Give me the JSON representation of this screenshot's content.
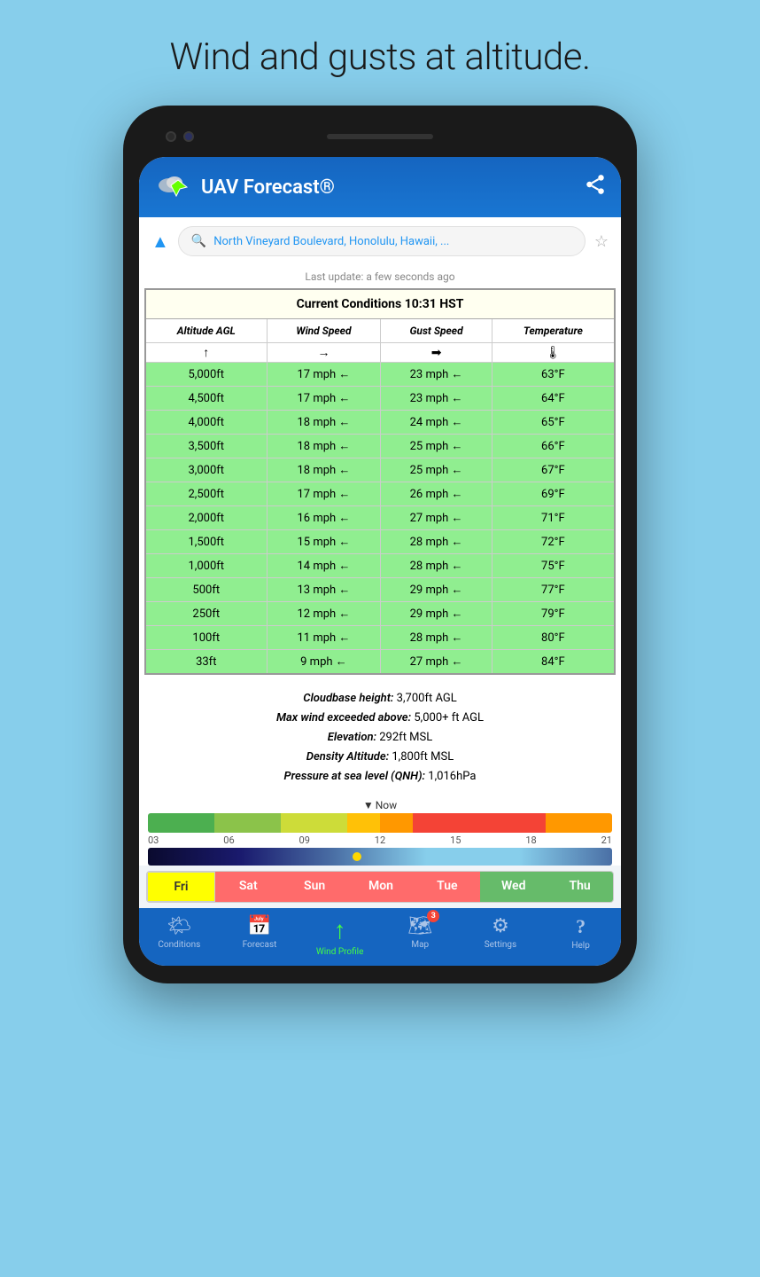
{
  "headline": "Wind and gusts at altitude.",
  "app": {
    "title": "UAV Forecast",
    "trademark": "®",
    "location": "North Vineyard Boulevard, Honolulu, Hawaii, ...",
    "last_update": "Last update: a few seconds ago"
  },
  "table": {
    "header": "Current Conditions 10:31 HST",
    "columns": [
      "Altitude AGL",
      "Wind Speed",
      "Gust Speed",
      "Temperature"
    ],
    "arrows": [
      "↑",
      "→",
      "➡",
      "🌡"
    ],
    "rows": [
      {
        "alt": "5,000ft",
        "wind": "17 mph ←",
        "gust": "23 mph ←",
        "temp": "63°F"
      },
      {
        "alt": "4,500ft",
        "wind": "17 mph ←",
        "gust": "23 mph ←",
        "temp": "64°F"
      },
      {
        "alt": "4,000ft",
        "wind": "18 mph ←",
        "gust": "24 mph ←",
        "temp": "65°F"
      },
      {
        "alt": "3,500ft",
        "wind": "18 mph ←",
        "gust": "25 mph ←",
        "temp": "66°F"
      },
      {
        "alt": "3,000ft",
        "wind": "18 mph ←",
        "gust": "25 mph ←",
        "temp": "67°F"
      },
      {
        "alt": "2,500ft",
        "wind": "17 mph ←",
        "gust": "26 mph ←",
        "temp": "69°F"
      },
      {
        "alt": "2,000ft",
        "wind": "16 mph ←",
        "gust": "27 mph ←",
        "temp": "71°F"
      },
      {
        "alt": "1,500ft",
        "wind": "15 mph ←",
        "gust": "28 mph ←",
        "temp": "72°F"
      },
      {
        "alt": "1,000ft",
        "wind": "14 mph ←",
        "gust": "28 mph ←",
        "temp": "75°F"
      },
      {
        "alt": "500ft",
        "wind": "13 mph ←",
        "gust": "29 mph ←",
        "temp": "77°F"
      },
      {
        "alt": "250ft",
        "wind": "12 mph ←",
        "gust": "29 mph ←",
        "temp": "79°F"
      },
      {
        "alt": "100ft",
        "wind": "11 mph ←",
        "gust": "28 mph ←",
        "temp": "80°F"
      },
      {
        "alt": "33ft",
        "wind": "9 mph ←",
        "gust": "27 mph ←",
        "temp": "84°F"
      }
    ]
  },
  "info": {
    "cloudbase": "3,700ft AGL",
    "max_wind": "5,000+ ft AGL",
    "elevation": "292ft MSL",
    "density_altitude": "1,800ft MSL",
    "pressure": "1,016hPa"
  },
  "timeline": {
    "now_label": "Now",
    "hours": [
      "03",
      "06",
      "09",
      "12",
      "15",
      "18",
      "21"
    ]
  },
  "days": [
    {
      "label": "Fri",
      "color": "day-fri",
      "active": true
    },
    {
      "label": "Sat",
      "color": "day-sat",
      "active": false
    },
    {
      "label": "Sun",
      "color": "day-sun",
      "active": false
    },
    {
      "label": "Mon",
      "color": "day-mon",
      "active": false
    },
    {
      "label": "Tue",
      "color": "day-tue",
      "active": false
    },
    {
      "label": "Wed",
      "color": "day-wed",
      "active": false
    },
    {
      "label": "Thu",
      "color": "day-thu",
      "active": false
    }
  ],
  "nav": {
    "items": [
      {
        "label": "Conditions",
        "icon": "🌤",
        "active": false
      },
      {
        "label": "Forecast",
        "icon": "📅",
        "active": false
      },
      {
        "label": "Wind Profile",
        "icon": "↑",
        "active": true
      },
      {
        "label": "Map",
        "icon": "🗺",
        "active": false,
        "badge": "3"
      },
      {
        "label": "Settings",
        "icon": "⚙",
        "active": false
      },
      {
        "label": "Help",
        "icon": "?",
        "active": false
      }
    ]
  }
}
